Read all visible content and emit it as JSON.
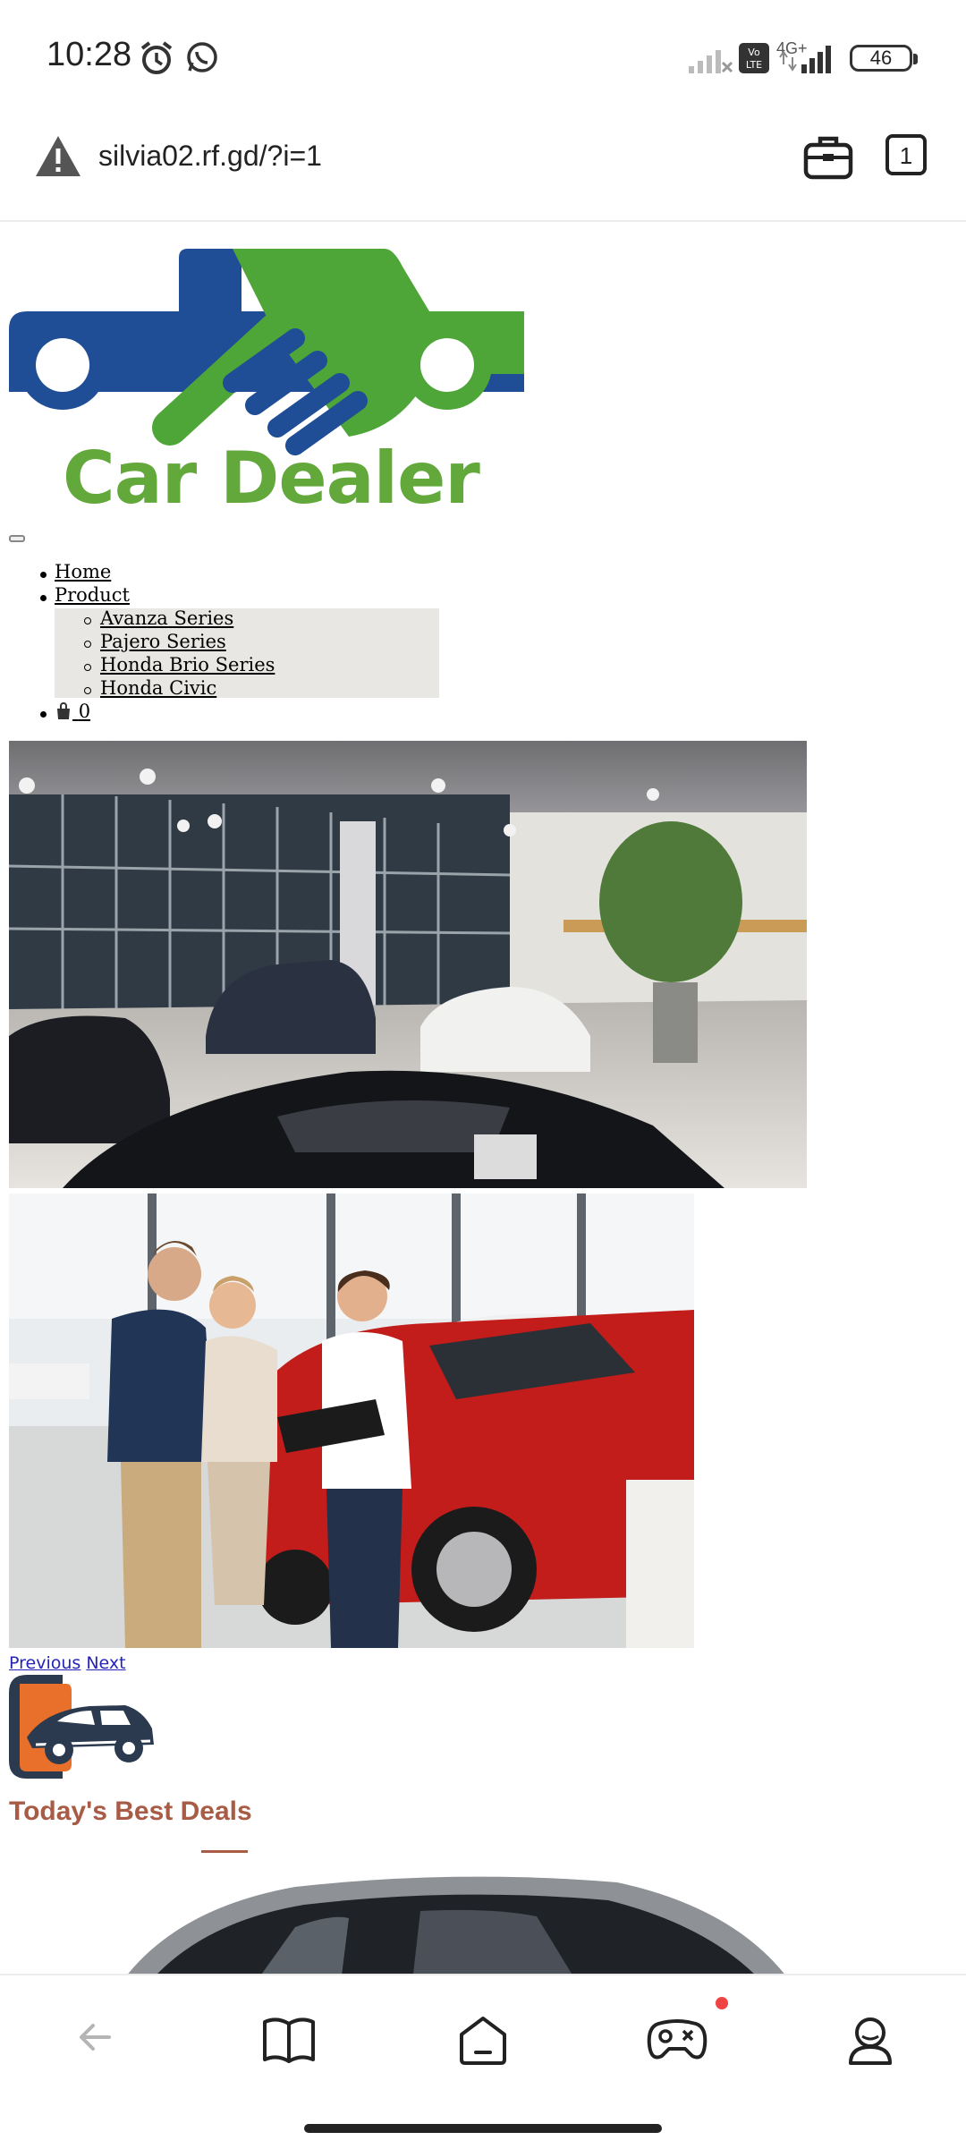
{
  "status_bar": {
    "time": "10:28",
    "network_label": "4G+",
    "volte_label": "Vo LTE",
    "battery": "46",
    "icons": [
      "alarm-icon",
      "whatsapp-icon",
      "signal-icon",
      "volte-icon",
      "battery-icon"
    ]
  },
  "url_bar": {
    "url": "silvia02.rf.gd/?i=1",
    "tab_count": "1",
    "icons": [
      "warning-icon",
      "briefcase-icon"
    ]
  },
  "site": {
    "logo_text": "Car Dealer",
    "nav": {
      "home": "Home",
      "product": "Product",
      "submenu": [
        "Avanza Series",
        "Pajero Series",
        "Honda Brio Series",
        "Honda Civic"
      ],
      "cart_count": "0"
    },
    "slider": {
      "previous": "Previous",
      "next": "Next"
    },
    "section_title": "Today's Best Deals"
  },
  "colors": {
    "logo_blue": "#1f4e96",
    "logo_green": "#4ea638",
    "section_title": "#a85b45",
    "link_blue": "#2424b8"
  },
  "bottom_nav": {
    "icons": [
      "back-icon",
      "bookmarks-icon",
      "home-icon",
      "games-icon",
      "profile-icon"
    ]
  }
}
